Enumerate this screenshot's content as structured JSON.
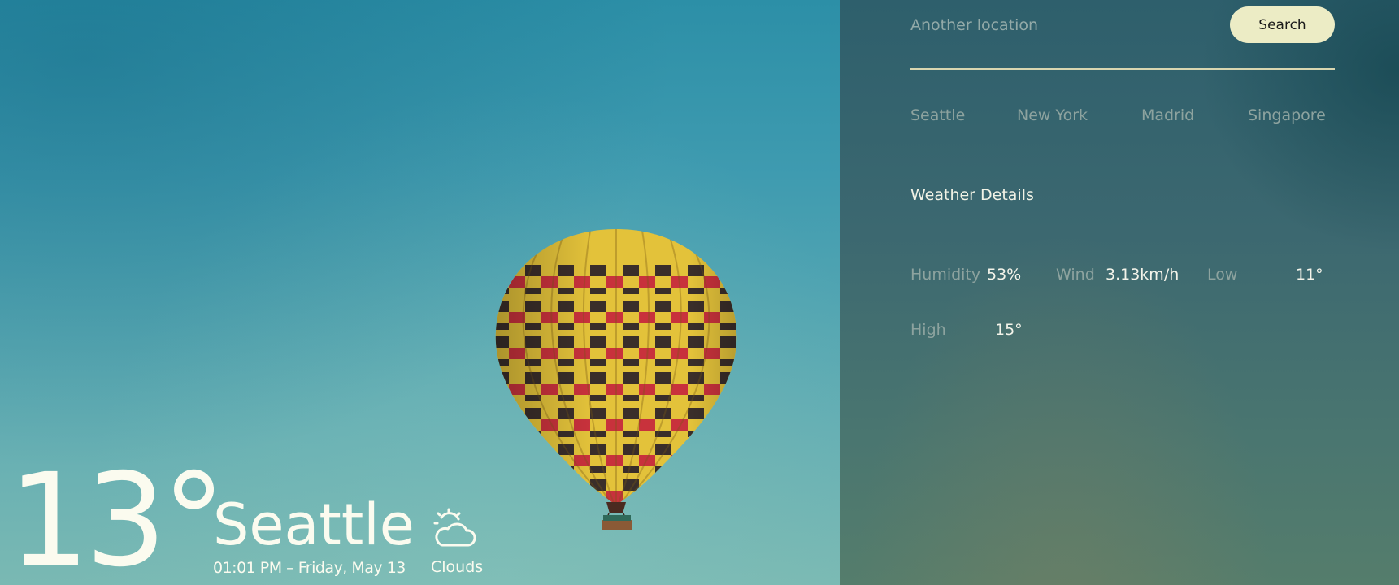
{
  "current": {
    "temperature": "13°",
    "city": "Seattle",
    "datetime": "01:01 PM – Friday, May 13",
    "condition": "Clouds",
    "condition_icon": "cloud-sun-icon"
  },
  "search": {
    "placeholder": "Another location",
    "button_label": "Search"
  },
  "quick_cities": [
    "Seattle",
    "New York",
    "Madrid",
    "Singapore"
  ],
  "details": {
    "title": "Weather Details",
    "items": [
      {
        "label": "Humidity",
        "value": "53%"
      },
      {
        "label": "Wind",
        "value": "3.13km/h"
      },
      {
        "label": "Low",
        "value": "11°"
      },
      {
        "label": "High",
        "value": "15°"
      }
    ]
  },
  "colors": {
    "accent_button": "#ececc5",
    "text_primary": "#fbfbef",
    "text_muted": "#8da39f"
  }
}
